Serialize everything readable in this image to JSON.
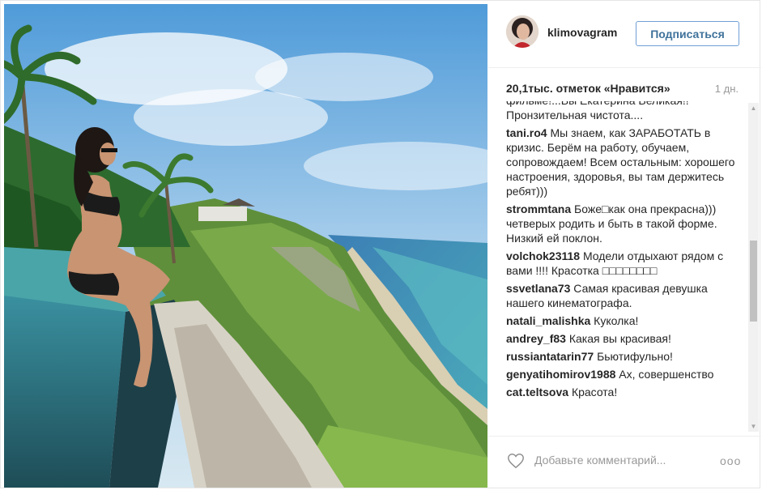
{
  "post": {
    "username": "klimovagram",
    "follow_label": "Подписаться",
    "likes": "20,1тыс. отметок «Нравится»",
    "time_ago": "1 дн.",
    "add_comment_placeholder": "Добавьте комментарий...",
    "more_label": "ooo"
  },
  "comments": [
    {
      "user": "",
      "text": "фильме!...Вы Екатерина Великая!! Пронзительная чистота...."
    },
    {
      "user": "tani.ro4",
      "text": "Мы знаем, как ЗАРАБОТАТЬ в кризис. Берём на работу, обучаем, сопровождаем! Всем остальным: хорошего настроения, здоровья, вы там держитесь ребят)))"
    },
    {
      "user": "strommtana",
      "text": "Боже□как она прекрасна))) четверых родить и быть в такой форме. Низкий ей поклон."
    },
    {
      "user": "volchok23118",
      "text": "Модели отдыхают рядом с вами !!!! Красотка □□□□□□□□"
    },
    {
      "user": "ssvetlana73",
      "text": "Самая красивая девушка нашего кинематографа."
    },
    {
      "user": "natali_malishka",
      "text": "Куколка!"
    },
    {
      "user": "andrey_f83",
      "text": "Какая вы красивая!"
    },
    {
      "user": "russiantatarin77",
      "text": "Бьютифульно!"
    },
    {
      "user": "genyatihomirov1988",
      "text": "Ах, совершенство"
    },
    {
      "user": "cat.teltsova",
      "text": "Красота!"
    }
  ]
}
